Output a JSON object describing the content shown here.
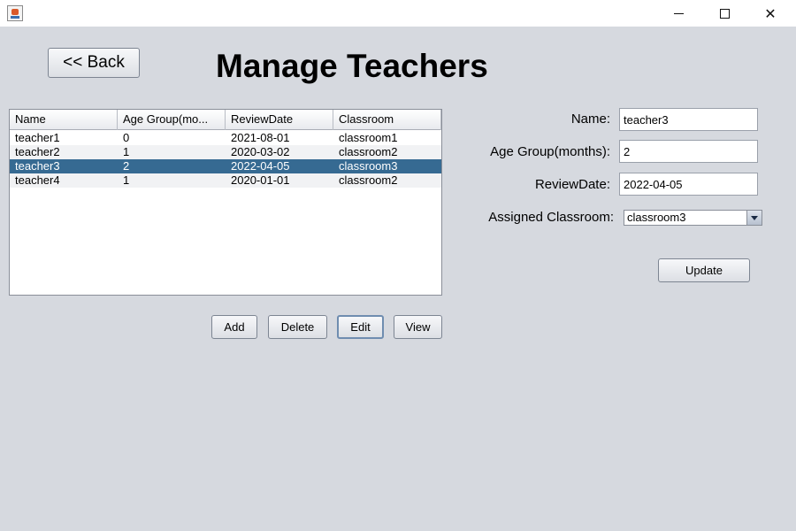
{
  "window": {
    "minimize_glyph": "",
    "maximize_glyph": "",
    "close_glyph": "✕"
  },
  "header": {
    "back_label": "<< Back",
    "title": "Manage Teachers"
  },
  "table": {
    "columns": [
      "Name",
      "Age Group(mo...",
      "ReviewDate",
      "Classroom"
    ],
    "rows": [
      [
        "teacher1",
        "0",
        "2021-08-01",
        "classroom1"
      ],
      [
        "teacher2",
        "1",
        "2020-03-02",
        "classroom2"
      ],
      [
        "teacher3",
        "2",
        "2022-04-05",
        "classroom3"
      ],
      [
        "teacher4",
        "1",
        "2020-01-01",
        "classroom2"
      ]
    ],
    "selected_row": 2
  },
  "actions": {
    "add_label": "Add",
    "delete_label": "Delete",
    "edit_label": "Edit",
    "view_label": "View"
  },
  "form": {
    "name_label": "Name:",
    "name_value": "teacher3",
    "age_label": "Age Group(months):",
    "age_value": "2",
    "review_label": "ReviewDate:",
    "review_value": "2022-04-05",
    "classroom_label": "Assigned Classroom:",
    "classroom_value": "classroom3",
    "update_label": "Update"
  },
  "colors": {
    "background": "#d6d9df",
    "selection": "#366a92"
  }
}
